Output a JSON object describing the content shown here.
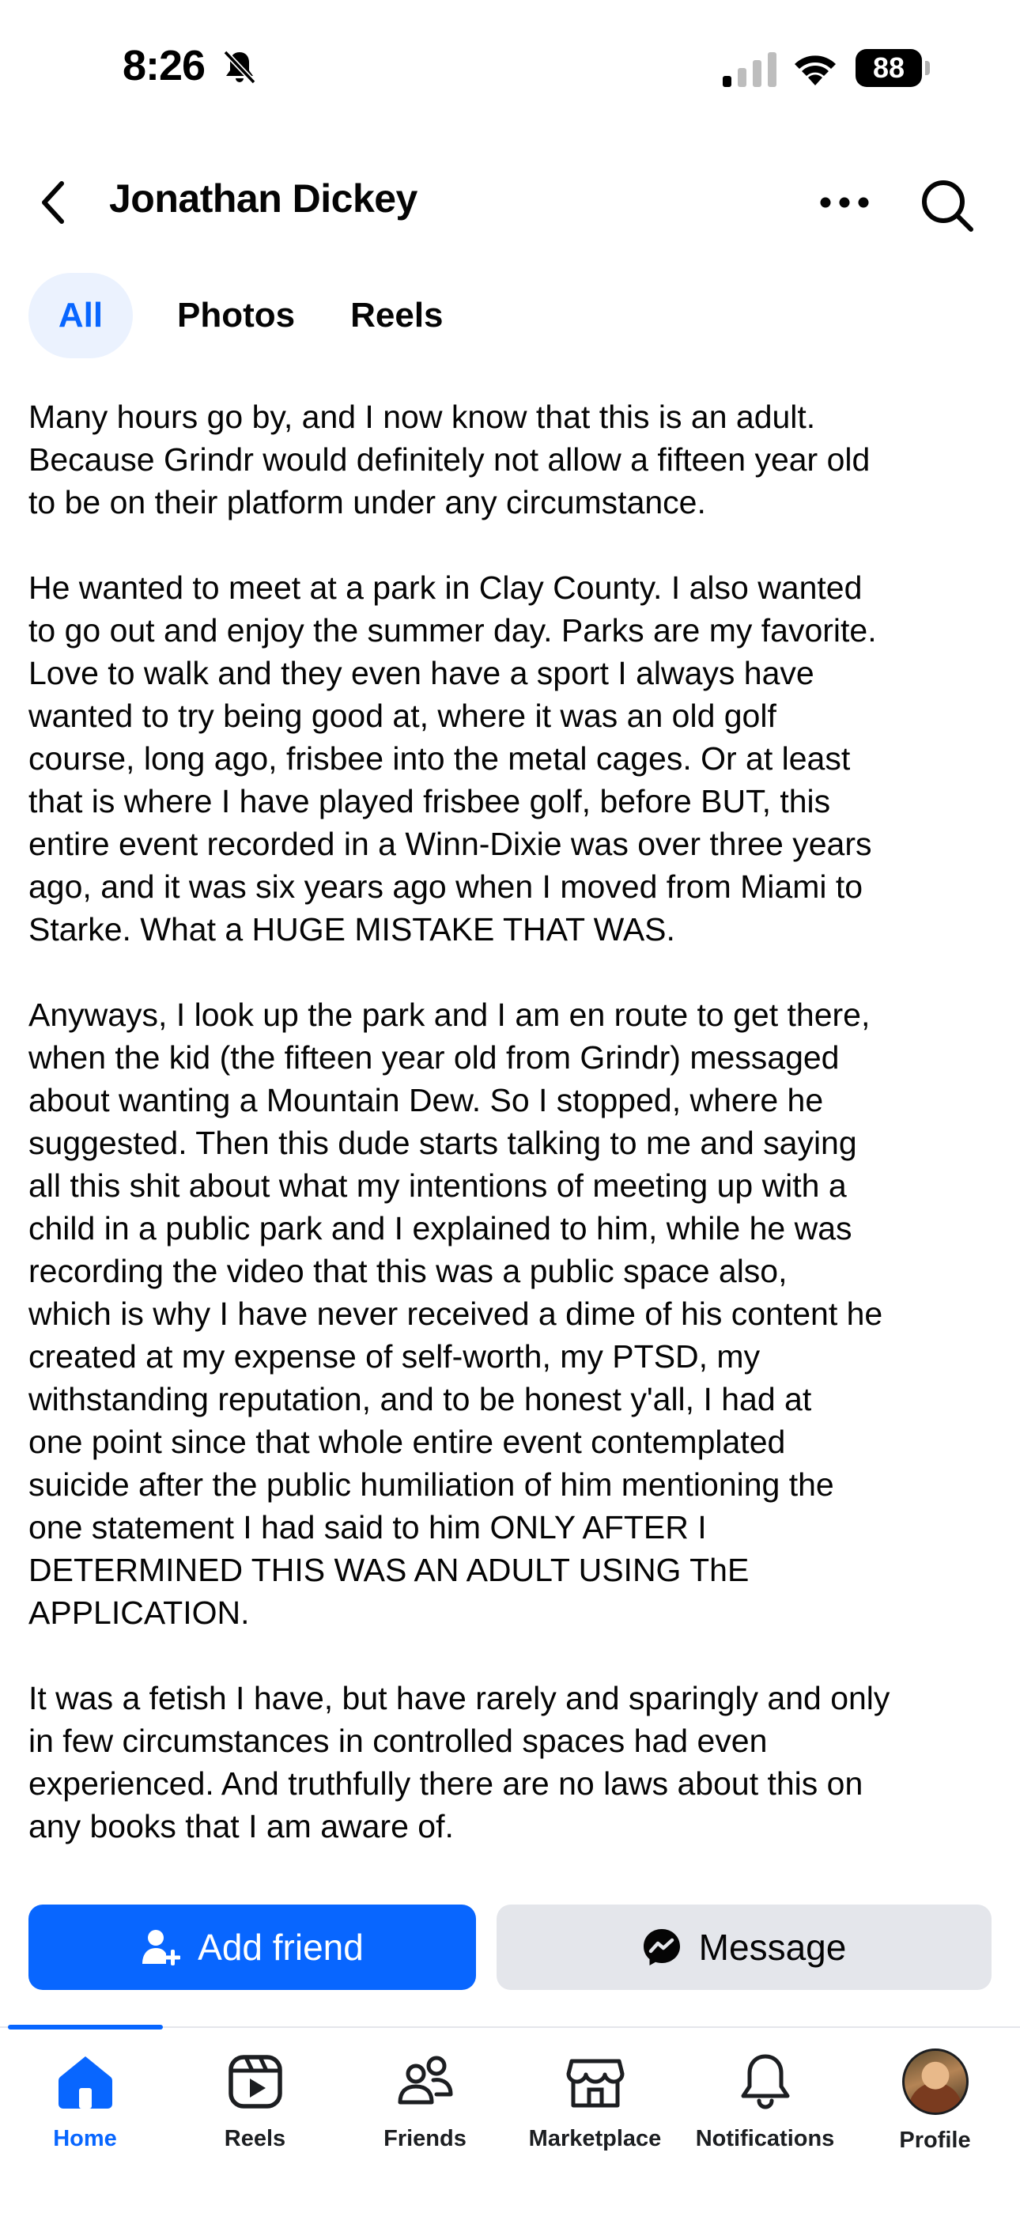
{
  "status_bar": {
    "time": "8:26",
    "battery": "88"
  },
  "header": {
    "title": "Jonathan Dickey"
  },
  "tabs": [
    {
      "label": "All",
      "active": true
    },
    {
      "label": "Photos",
      "active": false
    },
    {
      "label": "Reels",
      "active": false
    }
  ],
  "post": {
    "paragraphs": [
      "Many hours go by, and I now know that this is an adult.\nBecause Grindr would definitely not allow a fifteen year old\nto be on their platform under any circumstance.",
      "He wanted to meet at a park in Clay County. I also wanted\nto go out and enjoy the summer day. Parks are my favorite.\nLove to walk and they even have a sport I always have\nwanted to try being good at, where it was an old golf\ncourse, long ago, frisbee into the metal cages. Or at least\nthat is where I have played frisbee golf, before BUT,  this\nentire event recorded in a Winn-Dixie was over three years\nago, and it was six years ago when I moved from Miami to\nStarke. What a HUGE MISTAKE THAT WAS.",
      "Anyways, I look up the park and I am en route to get there,\nwhen the kid (the fifteen year old from Grindr) messaged\nabout wanting a Mountain Dew. So I stopped, where he\nsuggested. Then this dude starts talking to me and saying\nall this shit about what my intentions of meeting up with a\nchild in a public park and I explained to him, while he was\nrecording the video that this was a public space also,\nwhich is why I have never received a dime of his content he\ncreated at my expense of self-worth, my PTSD, my\nwithstanding reputation, and to be honest y'all,  I had at\none point since that whole entire event contemplated\nsuicide after the public humiliation of him mentioning the\none statement I had said to him ONLY AFTER I\nDETERMINED THIS WAS AN ADULT USING ThE\nAPPLICATION.",
      "It was a fetish I have, but have rarely and sparingly and only\nin few circumstances in controlled spaces had even\nexperienced. And truthfully there are no laws about this on\nany books that I am aware of."
    ]
  },
  "actions": {
    "add_friend": "Add friend",
    "message": "Message"
  },
  "bottom_nav": [
    {
      "label": "Home",
      "icon": "home-icon",
      "active": true
    },
    {
      "label": "Reels",
      "icon": "reels-icon",
      "active": false
    },
    {
      "label": "Friends",
      "icon": "friends-icon",
      "active": false
    },
    {
      "label": "Marketplace",
      "icon": "marketplace-icon",
      "active": false
    },
    {
      "label": "Notifications",
      "icon": "bell-icon",
      "active": false
    },
    {
      "label": "Profile",
      "icon": "avatar",
      "active": false
    }
  ],
  "colors": {
    "accent": "#0866ff",
    "accent_tab_bg": "#ebf2fe",
    "secondary_button_bg": "#e4e6eb",
    "text": "#050505"
  }
}
